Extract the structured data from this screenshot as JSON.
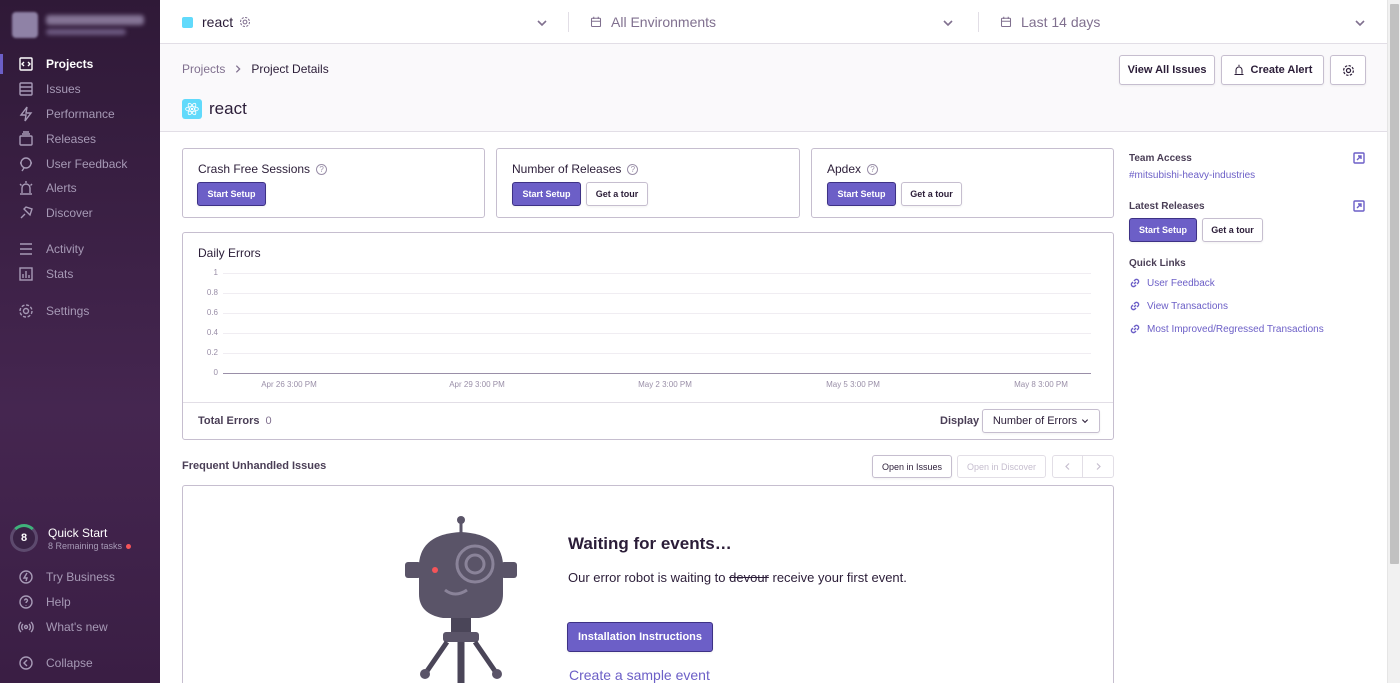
{
  "sidebar": {
    "items": [
      {
        "label": "Projects",
        "icon": "projects-icon"
      },
      {
        "label": "Issues",
        "icon": "issues-icon"
      },
      {
        "label": "Performance",
        "icon": "lightning-icon"
      },
      {
        "label": "Releases",
        "icon": "releases-icon"
      },
      {
        "label": "User Feedback",
        "icon": "feedback-icon"
      },
      {
        "label": "Alerts",
        "icon": "siren-icon"
      },
      {
        "label": "Discover",
        "icon": "discover-icon"
      },
      {
        "label": "Activity",
        "icon": "activity-icon"
      },
      {
        "label": "Stats",
        "icon": "stats-icon"
      },
      {
        "label": "Settings",
        "icon": "gear-icon"
      }
    ],
    "quick_start": {
      "count": "8",
      "title": "Quick Start",
      "subtitle": "8 Remaining tasks"
    },
    "bottom": [
      {
        "label": "Try Business"
      },
      {
        "label": "Help"
      },
      {
        "label": "What's new"
      },
      {
        "label": "Collapse"
      }
    ]
  },
  "topbar": {
    "project": "react",
    "environment": "All Environments",
    "period": "Last 14 days"
  },
  "header": {
    "breadcrumb_root": "Projects",
    "breadcrumb_current": "Project Details",
    "title": "react",
    "view_all_issues": "View All Issues",
    "create_alert": "Create Alert"
  },
  "score_cards": [
    {
      "title": "Crash Free Sessions",
      "start": "Start Setup"
    },
    {
      "title": "Number of Releases",
      "start": "Start Setup",
      "tour": "Get a tour"
    },
    {
      "title": "Apdex",
      "start": "Start Setup",
      "tour": "Get a tour"
    }
  ],
  "daily_errors": {
    "title": "Daily Errors",
    "total_label": "Total Errors",
    "total_value": "0",
    "display_label": "Display",
    "display_value": "Number of Errors"
  },
  "chart_data": {
    "type": "bar",
    "title": "Daily Errors",
    "x_ticks": [
      "Apr 26 3:00 PM",
      "Apr 29 3:00 PM",
      "May 2 3:00 PM",
      "May 5 3:00 PM",
      "May 8 3:00 PM"
    ],
    "y_ticks": [
      "1",
      "0.8",
      "0.6",
      "0.4",
      "0.2",
      "0"
    ],
    "ylim": [
      0,
      1
    ],
    "series": [
      {
        "values": []
      }
    ]
  },
  "issues": {
    "title": "Frequent Unhandled Issues",
    "open_in_issues": "Open in Issues",
    "open_in_discover": "Open in Discover"
  },
  "empty_state": {
    "heading": "Waiting for events…",
    "text_before": "Our error robot is waiting to ",
    "struck": "devour",
    "text_after": " receive your first event.",
    "install_button": "Installation Instructions",
    "sample_link": "Create a sample event"
  },
  "side": {
    "team_access_title": "Team Access",
    "team_link": "#mitsubishi-heavy-industries",
    "latest_releases_title": "Latest Releases",
    "start_setup": "Start Setup",
    "get_tour": "Get a tour",
    "quick_links_title": "Quick Links",
    "quick_links": [
      "User Feedback",
      "View Transactions",
      "Most Improved/Regressed Transactions"
    ]
  },
  "colors": {
    "accent": "#6c5fc7",
    "sidebar": "#2f1937",
    "react_badge": "#61dafb"
  }
}
